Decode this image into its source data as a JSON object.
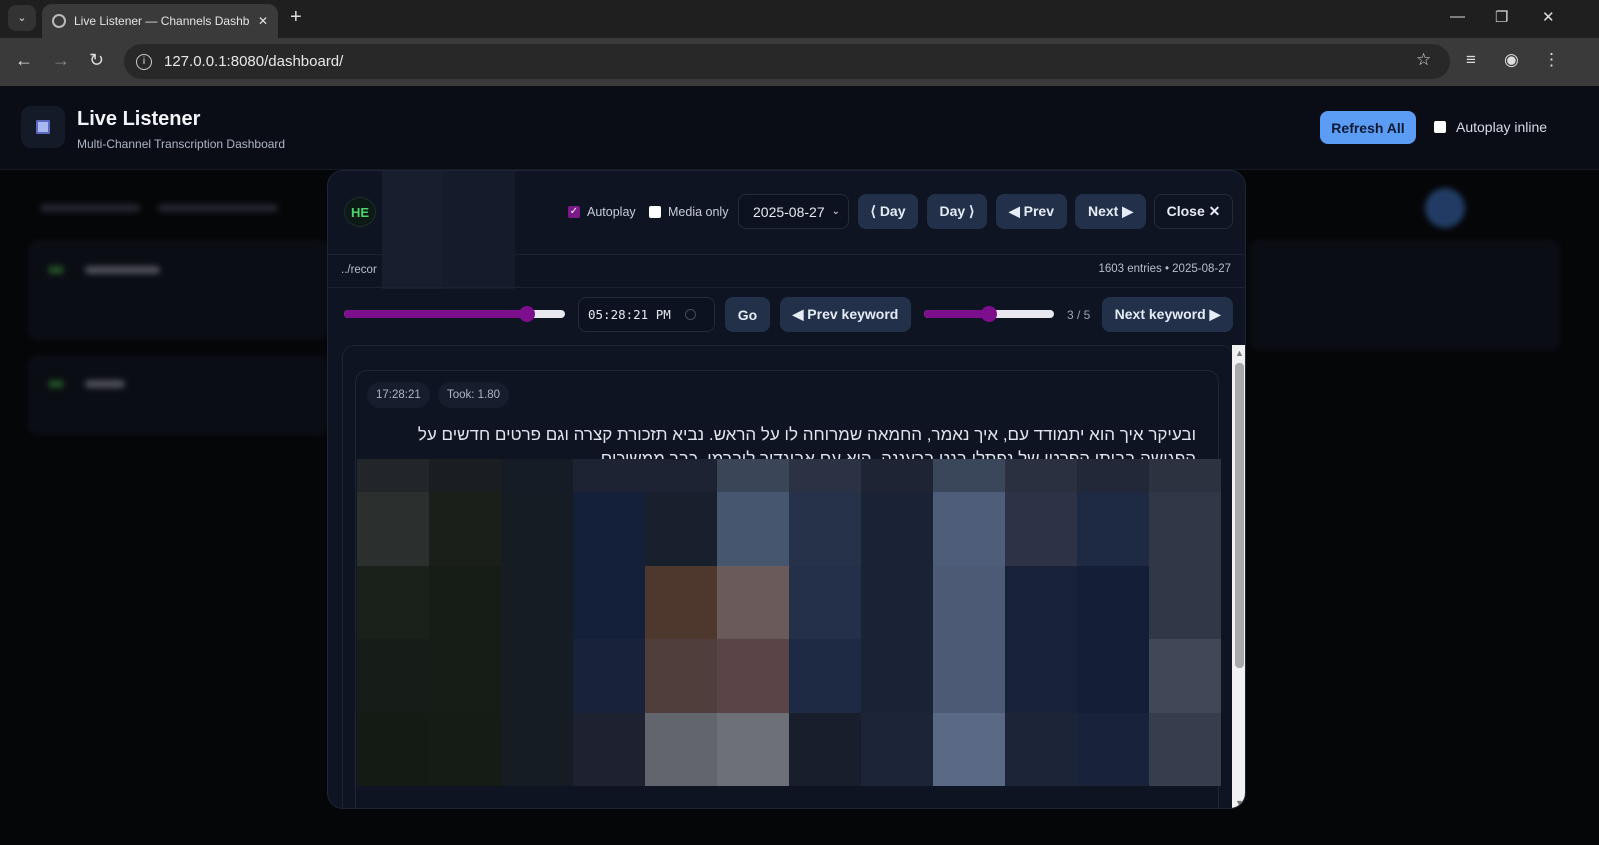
{
  "browser": {
    "tab_title": "Live Listener — Channels Dashb",
    "url": "127.0.0.1:8080/dashboard/"
  },
  "header": {
    "title": "Live Listener",
    "subtitle": "Multi-Channel Transcription Dashboard",
    "refresh_label": "Refresh All",
    "autoplay_inline_label": "Autoplay inline",
    "autoplay_inline_checked": false
  },
  "modal": {
    "lang_badge": "HE",
    "autoplay_label": "Autoplay",
    "autoplay_checked": true,
    "media_only_label": "Media only",
    "media_only_checked": false,
    "date_value": "2025-08-27",
    "prev_day_label": "⟨ Day",
    "next_day_label": "Day ⟩",
    "prev_label": "◀ Prev",
    "next_label": "Next ▶",
    "close_label": "Close ✕",
    "path": "../recor",
    "entries_info": "1603 entries • 2025-08-27",
    "timeline_position": 0.83,
    "time_value": "05:28:21 PM",
    "go_label": "Go",
    "prev_keyword_label": "◀ Prev keyword",
    "next_keyword_label": "Next keyword ▶",
    "keyword_position": 0.5,
    "keyword_count": "3 / 5",
    "entry": {
      "time": "17:28:21",
      "took": "Took: 1.80",
      "text": "ובעיקר איך הוא יתמודד עם,  איך נאמר, החמאה שמרוחה לו על הראש. נביא תזכורת קצרה וגם פרטים חדשים על הפגישה בביתו הפרטי של נפתלי בנט ברעננה,  הוא עם אביגדור ליברמן.  כבר ממשיכים."
    },
    "media_pixel_colors": [
      [
        "#22262b",
        "#1a1e22",
        "#161c26",
        "#1d2333",
        "#1d2333",
        "#3a4658",
        "#2a3244",
        "#1e2434",
        "#3a465a",
        "#2a3040",
        "#222838",
        "#2c3240"
      ],
      [
        "#2b302e",
        "#1a1f1a",
        "#151c24",
        "#14203a",
        "#18202e",
        "#45566e",
        "#26324a",
        "#1a2236",
        "#4e5e7a",
        "#2e3246",
        "#1e2a44",
        "#303848"
      ],
      [
        "#1a201a",
        "#161c16",
        "#151c24",
        "#14203a",
        "#4e382e",
        "#6a5a5a",
        "#24304a",
        "#1a2236",
        "#4c5a76",
        "#18233a",
        "#141e36",
        "#303848"
      ],
      [
        "#161c18",
        "#161c16",
        "#151c24",
        "#18223a",
        "#503e3c",
        "#5a4448",
        "#1e2a44",
        "#1a2236",
        "#4c5a76",
        "#18233a",
        "#141e36",
        "#404858"
      ],
      [
        "#141a14",
        "#151c16",
        "#151c24",
        "#1e2230",
        "#62646e",
        "#6e7078",
        "#181e2c",
        "#1c2438",
        "#5a6a86",
        "#1c2438",
        "#18223a",
        "#363e4e"
      ]
    ]
  },
  "colors": {
    "accent": "#5b9cf5",
    "slider": "#7d0e8c",
    "live_green": "#4ed36a"
  }
}
